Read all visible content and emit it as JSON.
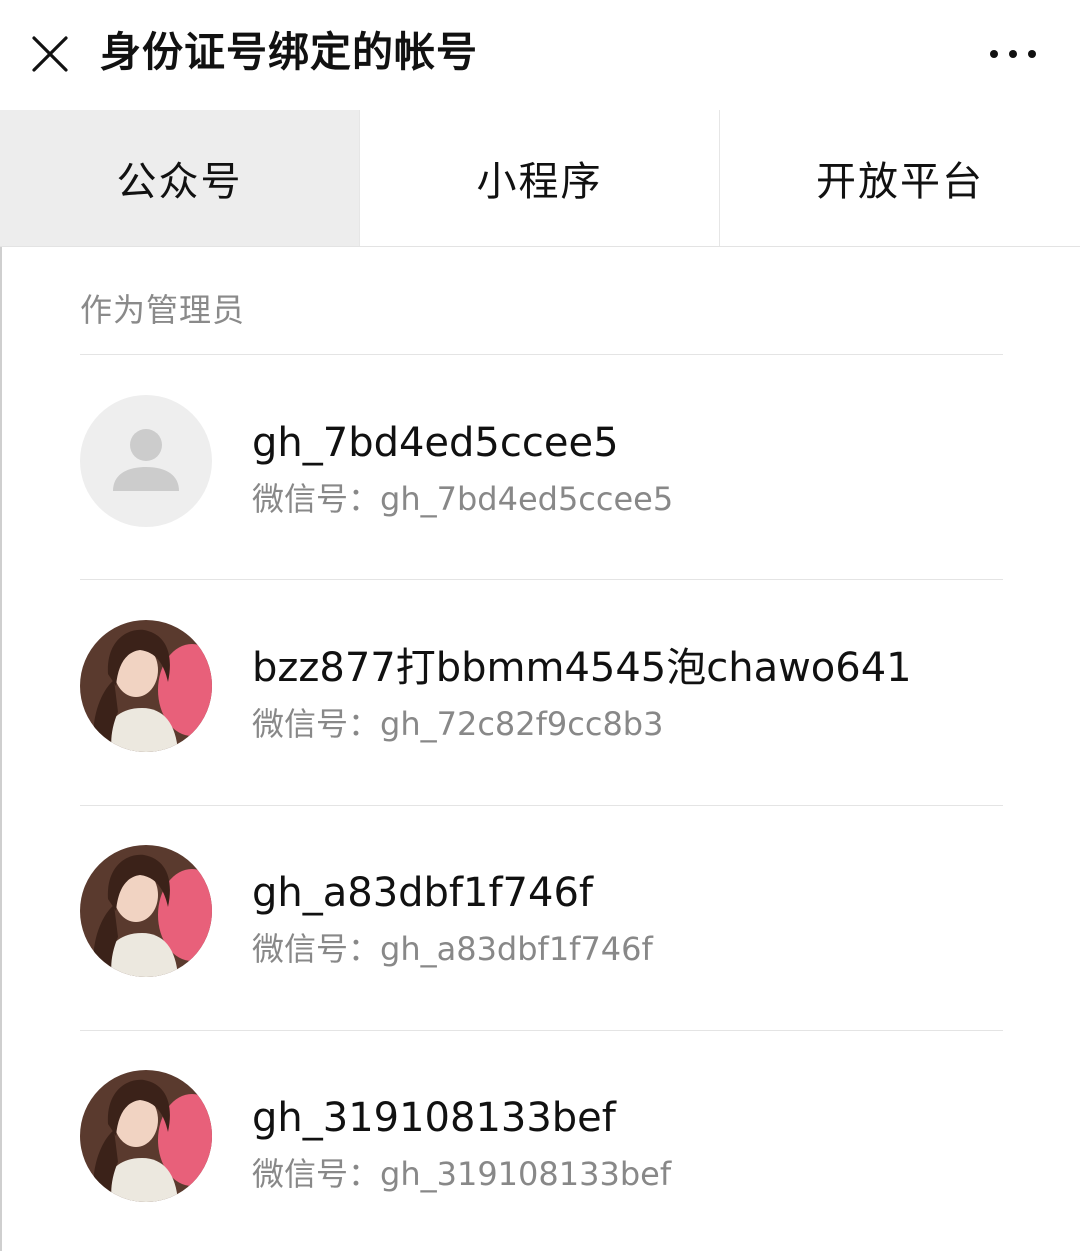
{
  "header": {
    "title": "身份证号绑定的帐号",
    "close_icon": "close-icon",
    "more_icon": "more-options-icon"
  },
  "tabs": [
    {
      "label": "公众号",
      "active": true
    },
    {
      "label": "小程序",
      "active": false
    },
    {
      "label": "开放平台",
      "active": false
    }
  ],
  "section": {
    "label": "作为管理员"
  },
  "accounts": [
    {
      "name": "gh_7bd4ed5ccee5",
      "id_line": "微信号：gh_7bd4ed5ccee5",
      "avatar": "default-avatar-icon"
    },
    {
      "name": "bzz877打bbmm4545泡chawo641",
      "id_line": "微信号：gh_72c82f9cc8b3",
      "avatar": "profile-photo"
    },
    {
      "name": "gh_a83dbf1f746f",
      "id_line": "微信号：gh_a83dbf1f746f",
      "avatar": "profile-photo"
    },
    {
      "name": "gh_319108133bef",
      "id_line": "微信号：gh_319108133bef",
      "avatar": "profile-photo"
    }
  ],
  "colors": {
    "active_tab_bg": "#ededed",
    "secondary_text": "#888888",
    "divider": "#e4e4e4"
  }
}
